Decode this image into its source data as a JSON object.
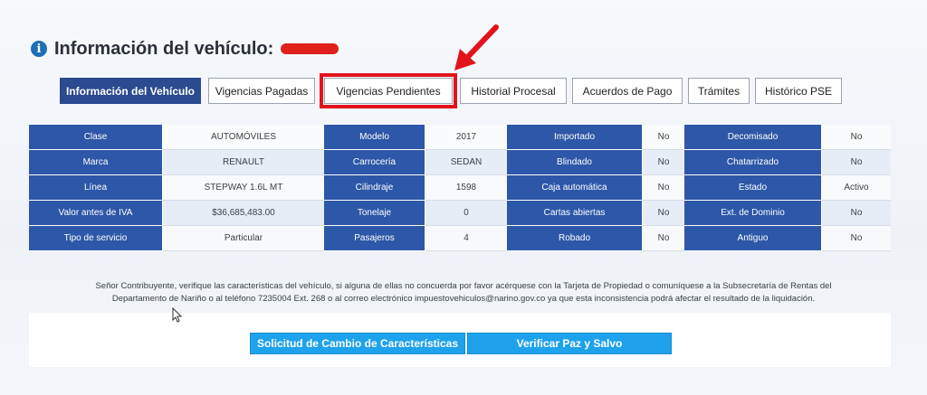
{
  "header": {
    "title": "Información del vehículo:"
  },
  "tabs": [
    {
      "label": "Información del Vehículo",
      "active": true
    },
    {
      "label": "Vigencias Pagadas"
    },
    {
      "label": "Vigencias Pendientes",
      "highlighted": true
    },
    {
      "label": "Historial Procesal"
    },
    {
      "label": "Acuerdos de Pago"
    },
    {
      "label": "Trámites"
    },
    {
      "label": "Histórico PSE"
    }
  ],
  "table": {
    "rows": [
      [
        "Clase",
        "AUTOMÓVILES",
        "Modelo",
        "2017",
        "Importado",
        "No",
        "Decomisado",
        "No"
      ],
      [
        "Marca",
        "RENAULT",
        "Carrocería",
        "SEDAN",
        "Blindado",
        "No",
        "Chatarrizado",
        "No"
      ],
      [
        "Línea",
        "STEPWAY 1.6L MT",
        "Cilindraje",
        "1598",
        "Caja automática",
        "No",
        "Estado",
        "Activo"
      ],
      [
        "Valor antes de IVA",
        "$36,685,483.00",
        "Tonelaje",
        "0",
        "Cartas abiertas",
        "No",
        "Ext. de Dominio",
        "No"
      ],
      [
        "Tipo de servicio",
        "Particular",
        "Pasajeros",
        "4",
        "Robado",
        "No",
        "Antiguo",
        "No"
      ]
    ]
  },
  "notice": {
    "line1": "Señor Contribuyente, verifique las características del vehículo, si alguna de ellas no concuerda por favor acérquese con la Tarjeta de Propiedad o comuníquese a la Subsecretaría de Rentas del",
    "line2": "Departamento de Nariño o al teléfono 7235004 Ext. 268 o al correo electrónico impuestovehiculos@narino.gov.co ya que esta inconsistencia podrá afectar el resultado de la liquidación."
  },
  "buttons": {
    "change_request": "Solicitud de Cambio de Características",
    "verify": "Verificar Paz y Salvo"
  },
  "colors": {
    "header_cell": "#2d57a8",
    "active_tab": "#2b4a8f",
    "highlight": "#e3131b",
    "button": "#1ea2ec"
  }
}
